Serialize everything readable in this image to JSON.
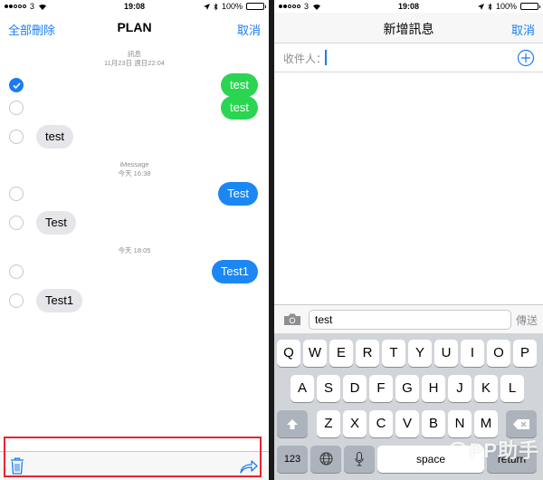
{
  "left": {
    "status": {
      "carrier": "3",
      "time": "19:08",
      "battery": "100%"
    },
    "nav": {
      "left": "全部刪除",
      "title": "PLAN",
      "right": "取消"
    },
    "stamps": [
      {
        "line1": "訊息",
        "line2": "11月23日 週日22:04"
      },
      {
        "line1": "iMessage",
        "line2": "今天 16:38"
      },
      {
        "line1": "",
        "line2": "今天 18:05"
      }
    ],
    "messages": [
      {
        "text": "test",
        "dir": "out",
        "color": "green",
        "checked": true
      },
      {
        "text": "test",
        "dir": "out",
        "color": "green",
        "checked": false
      },
      {
        "text": "test",
        "dir": "in",
        "checked": false
      },
      {
        "text": "Test",
        "dir": "out",
        "color": "blue",
        "checked": false
      },
      {
        "text": "Test",
        "dir": "in",
        "checked": false
      },
      {
        "text": "Test1",
        "dir": "out",
        "color": "blue",
        "checked": false
      },
      {
        "text": "Test1",
        "dir": "in",
        "checked": false
      }
    ],
    "toolbar": {
      "left_icon": "trash-icon",
      "right_icon": "share-icon"
    }
  },
  "right": {
    "status": {
      "carrier": "3",
      "time": "19:08",
      "battery": "100%"
    },
    "nav": {
      "title": "新增訊息",
      "right": "取消"
    },
    "to_label": "收件人：",
    "compose": {
      "value": "test",
      "send_label": "傳送"
    },
    "keyboard": {
      "row1": [
        "Q",
        "W",
        "E",
        "R",
        "T",
        "Y",
        "U",
        "I",
        "O",
        "P"
      ],
      "row2": [
        "A",
        "S",
        "D",
        "F",
        "G",
        "H",
        "J",
        "K",
        "L"
      ],
      "row3": [
        "Z",
        "X",
        "C",
        "V",
        "B",
        "N",
        "M"
      ],
      "numbers_key": "123",
      "space_key": "space",
      "return_key": "return"
    },
    "watermark": "PP助手"
  },
  "colors": {
    "accent": "#1a7cf5",
    "sms_green": "#2ad552",
    "imessage_blue": "#1a87f5",
    "highlight": "#e8242f"
  }
}
